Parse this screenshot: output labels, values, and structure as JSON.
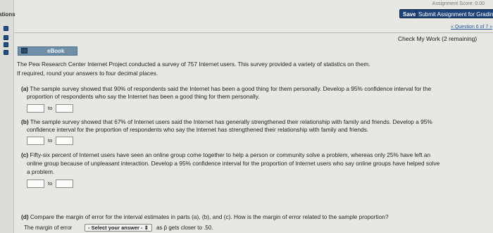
{
  "sidebar": {
    "label": "ations"
  },
  "header": {
    "assignment_score": "Assignment Score: 0.00",
    "save_label": "Save",
    "submit_label": "Submit Assignment for Grading",
    "question_nav": "« Question 6 of 7 »"
  },
  "check_work": "Check My Work (2 remaining)",
  "ebook": {
    "label": "eBook"
  },
  "intro": {
    "line1": "The Pew Research Center Internet Project conducted a survey of 757 Internet users. This survey provided a variety of statistics on them.",
    "line2": "If required, round your answers to four decimal places."
  },
  "parts": {
    "a": {
      "letter": "(a)",
      "text1": "The sample survey showed that 90% of respondents said the Internet has been a good thing for them personally. Develop a 95% confidence interval for the",
      "text2": "proportion of respondents who say the Internet has been a good thing for them personally."
    },
    "b": {
      "letter": "(b)",
      "text1": "The sample survey showed that 67% of Internet users said the Internet has generally strengthened their relationship with family and friends. Develop a 95%",
      "text2": "confidence interval for the proportion of respondents who say the Internet has strengthened their relationship with family and friends."
    },
    "c": {
      "letter": "(c)",
      "text1": "Fifty-six percent of Internet users have seen an online group come together to help a person or community solve a problem, whereas only 25% have left an",
      "text2": "online group because of unpleasant interaction. Develop a 95% confidence interval for the proportion of Internet users who say online groups have helped solve",
      "text3": "a problem."
    },
    "d": {
      "letter": "(d)",
      "text1": "Compare the margin of error for the interval estimates in parts (a), (b), and (c). How is the margin of error related to the sample proportion?",
      "margin_label": "The margin of error",
      "select_value": "- Select your answer -",
      "after_select": "as p̄ gets closer to .50."
    }
  },
  "to_label": "to"
}
